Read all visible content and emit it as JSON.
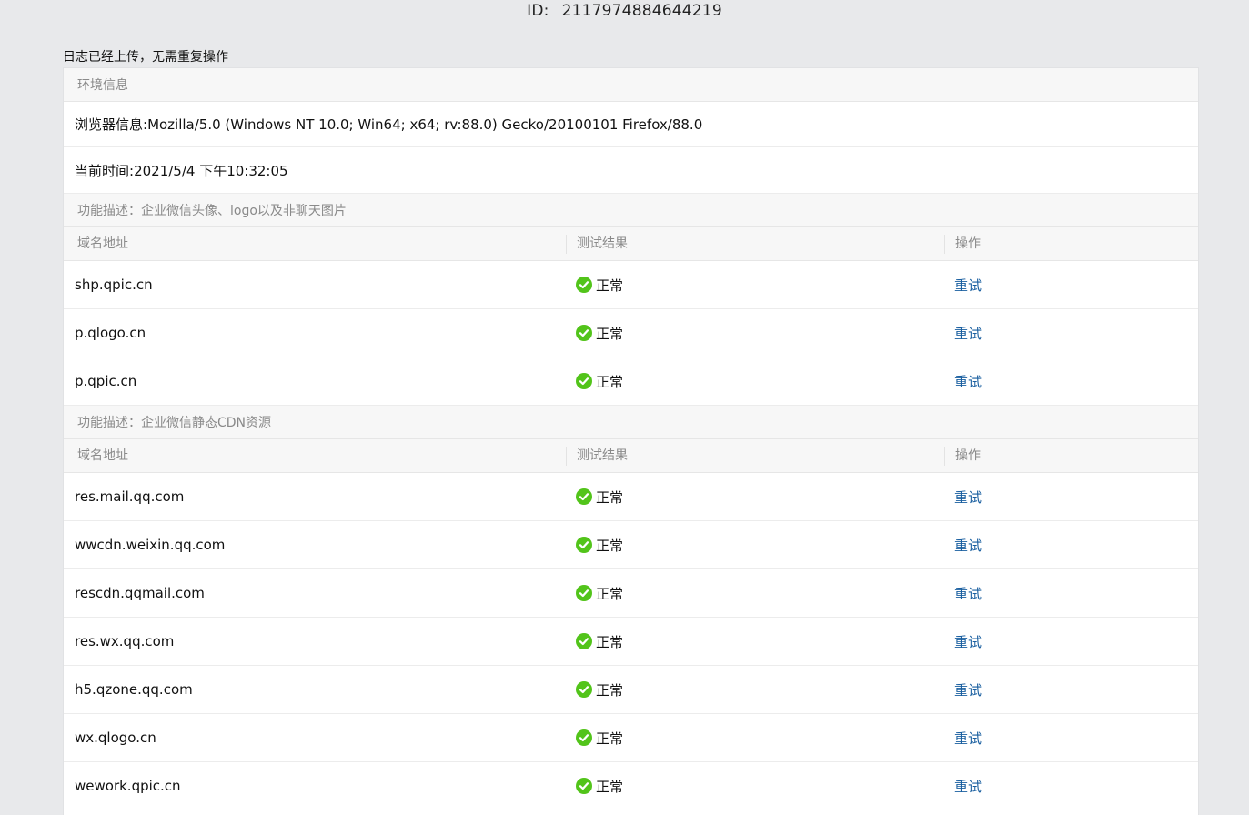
{
  "header": {
    "id_label": "ID:",
    "id_value": "2117974884644219"
  },
  "upload_note": "日志已经上传，无需重复操作",
  "env": {
    "title": "环境信息",
    "browser_label": "浏览器信息:",
    "browser_value": "Mozilla/5.0 (Windows NT 10.0; Win64; x64; rv:88.0) Gecko/20100101 Firefox/88.0",
    "time_label": "当前时间:",
    "time_value": "2021/5/4 下午10:32:05"
  },
  "columns": {
    "domain": "域名地址",
    "result": "测试结果",
    "action": "操作"
  },
  "sections": [
    {
      "title": "功能描述：企业微信头像、logo以及非聊天图片",
      "rows": [
        {
          "domain": "shp.qpic.cn",
          "status": "正常",
          "action": "重试"
        },
        {
          "domain": "p.qlogo.cn",
          "status": "正常",
          "action": "重试"
        },
        {
          "domain": "p.qpic.cn",
          "status": "正常",
          "action": "重试"
        }
      ]
    },
    {
      "title": "功能描述：企业微信静态CDN资源",
      "rows": [
        {
          "domain": "res.mail.qq.com",
          "status": "正常",
          "action": "重试"
        },
        {
          "domain": "wwcdn.weixin.qq.com",
          "status": "正常",
          "action": "重试"
        },
        {
          "domain": "rescdn.qqmail.com",
          "status": "正常",
          "action": "重试"
        },
        {
          "domain": "res.wx.qq.com",
          "status": "正常",
          "action": "重试"
        },
        {
          "domain": "h5.qzone.qq.com",
          "status": "正常",
          "action": "重试"
        },
        {
          "domain": "wx.qlogo.cn",
          "status": "正常",
          "action": "重试"
        },
        {
          "domain": "wework.qpic.cn",
          "status": "正常",
          "action": "重试"
        }
      ]
    }
  ],
  "colors": {
    "ok": "#52c41a",
    "link": "#1a5fa0",
    "background": "#e8e9eb"
  },
  "icons": {
    "status_ok": "check-circle-icon"
  }
}
